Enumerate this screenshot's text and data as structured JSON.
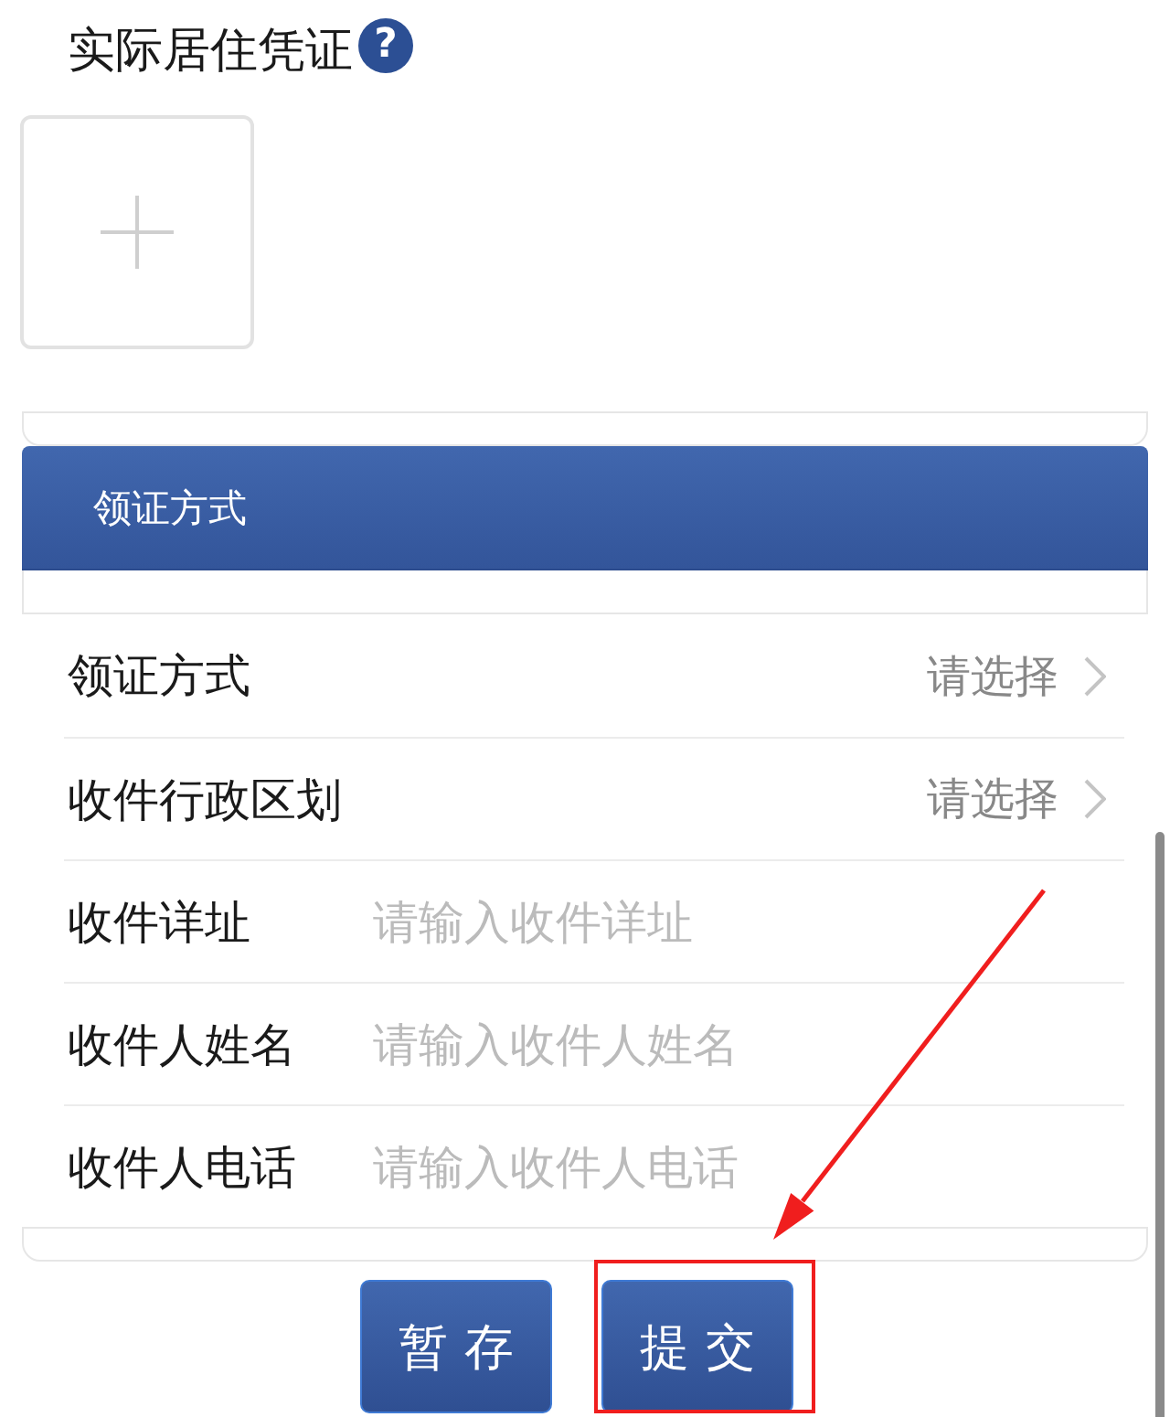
{
  "section": {
    "title": "实际居住凭证",
    "help": "?"
  },
  "upload": {
    "kind": "add"
  },
  "panel": {
    "title": "领证方式"
  },
  "fields": [
    {
      "kind": "select",
      "label": "领证方式",
      "placeholder": "请选择"
    },
    {
      "kind": "select",
      "label": "收件行政区划",
      "placeholder": "请选择"
    },
    {
      "kind": "input",
      "label": "收件详址",
      "placeholder": "请输入收件详址"
    },
    {
      "kind": "input",
      "label": "收件人姓名",
      "placeholder": "请输入收件人姓名"
    },
    {
      "kind": "input",
      "label": "收件人电话",
      "placeholder": "请输入收件人电话"
    }
  ],
  "buttons": [
    {
      "label": "暂 存",
      "highlighted": false
    },
    {
      "label": "提 交",
      "highlighted": true
    }
  ],
  "annotation_arrow": true
}
